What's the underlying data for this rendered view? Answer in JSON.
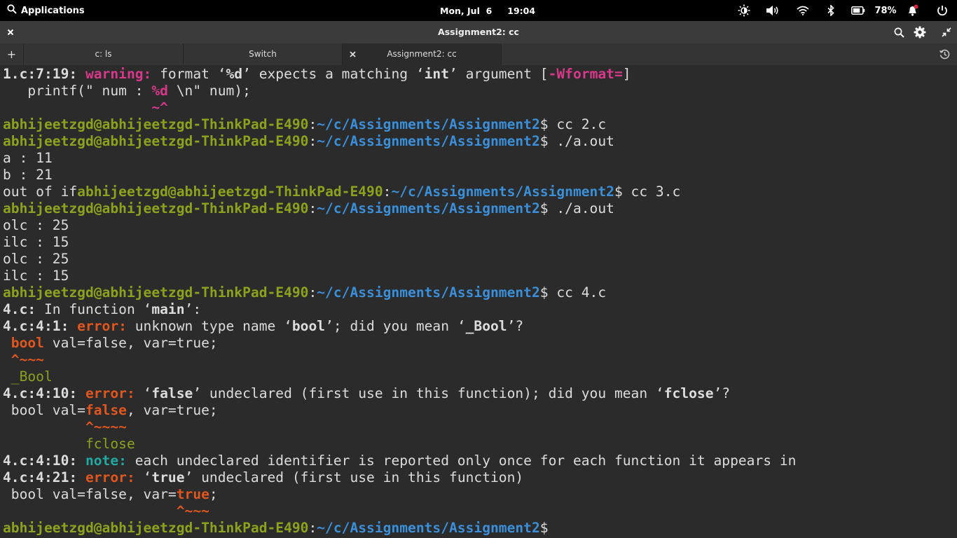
{
  "top_panel": {
    "applications_label": "Applications",
    "date": "Mon, Jul  6",
    "time": "19:04",
    "battery_percent": "78%",
    "indicators": [
      "night-light-icon",
      "volume-icon",
      "wifi-icon",
      "bluetooth-icon",
      "battery-icon",
      "notifications-icon",
      "power-icon"
    ]
  },
  "window": {
    "title": "Assignment2: cc",
    "tabs": [
      {
        "label": "c: ls"
      },
      {
        "label": "Switch"
      },
      {
        "label": "Assignment2: cc"
      }
    ]
  },
  "colors": {
    "user": "#8ca21c",
    "path": "#3a8fd8",
    "warning": "#d8388a",
    "error": "#e0561f",
    "note": "#1fa9a0"
  },
  "terminal": {
    "lines": [
      [
        {
          "t": "1.c:7:19: ",
          "s": "b"
        },
        {
          "t": "warning:",
          "s": "warn"
        },
        {
          "t": " format ‘"
        },
        {
          "t": "%d",
          "s": "b"
        },
        {
          "t": "’ expects a matching ‘"
        },
        {
          "t": "int",
          "s": "b"
        },
        {
          "t": "’ argument ["
        },
        {
          "t": "-Wformat=",
          "s": "warn"
        },
        {
          "t": "]"
        }
      ],
      [
        {
          "t": "   printf(\" num : "
        },
        {
          "t": "%d",
          "s": "warn"
        },
        {
          "t": " \\n\" num);"
        }
      ],
      [
        {
          "t": "                  "
        },
        {
          "t": "~^",
          "s": "warn"
        }
      ],
      [
        {
          "t": "abhijeetzgd@abhijeetzgd-ThinkPad-E490",
          "s": "usr"
        },
        {
          "t": ":"
        },
        {
          "t": "~/c/Assignments/Assignment2",
          "s": "pth"
        },
        {
          "t": "$ cc 2.c"
        }
      ],
      [
        {
          "t": "abhijeetzgd@abhijeetzgd-ThinkPad-E490",
          "s": "usr"
        },
        {
          "t": ":"
        },
        {
          "t": "~/c/Assignments/Assignment2",
          "s": "pth"
        },
        {
          "t": "$ ./a.out"
        }
      ],
      [
        {
          "t": "a : 11"
        }
      ],
      [
        {
          "t": "b : 21"
        }
      ],
      [
        {
          "t": "out of if"
        },
        {
          "t": "abhijeetzgd@abhijeetzgd-ThinkPad-E490",
          "s": "usr"
        },
        {
          "t": ":"
        },
        {
          "t": "~/c/Assignments/Assignment2",
          "s": "pth"
        },
        {
          "t": "$ cc 3.c"
        }
      ],
      [
        {
          "t": "abhijeetzgd@abhijeetzgd-ThinkPad-E490",
          "s": "usr"
        },
        {
          "t": ":"
        },
        {
          "t": "~/c/Assignments/Assignment2",
          "s": "pth"
        },
        {
          "t": "$ ./a.out"
        }
      ],
      [
        {
          "t": "olc : 25"
        }
      ],
      [
        {
          "t": "ilc : 15"
        }
      ],
      [
        {
          "t": "olc : 25"
        }
      ],
      [
        {
          "t": "ilc : 15"
        }
      ],
      [
        {
          "t": "abhijeetzgd@abhijeetzgd-ThinkPad-E490",
          "s": "usr"
        },
        {
          "t": ":"
        },
        {
          "t": "~/c/Assignments/Assignment2",
          "s": "pth"
        },
        {
          "t": "$ cc 4.c"
        }
      ],
      [
        {
          "t": "4.c:",
          "s": "b"
        },
        {
          "t": " In function ‘"
        },
        {
          "t": "main",
          "s": "b"
        },
        {
          "t": "’:"
        }
      ],
      [
        {
          "t": "4.c:4:1: ",
          "s": "b"
        },
        {
          "t": "error:",
          "s": "err"
        },
        {
          "t": " unknown type name ‘"
        },
        {
          "t": "bool",
          "s": "b"
        },
        {
          "t": "’; did you mean ‘"
        },
        {
          "t": "_Bool",
          "s": "b"
        },
        {
          "t": "’?"
        }
      ],
      [
        {
          "t": " "
        },
        {
          "t": "bool",
          "s": "err"
        },
        {
          "t": " val=false, var=true;"
        }
      ],
      [
        {
          "t": " "
        },
        {
          "t": "^~~~",
          "s": "err"
        }
      ],
      [
        {
          "t": " "
        },
        {
          "t": "_Bool",
          "s": "sugg"
        }
      ],
      [
        {
          "t": "4.c:4:10: ",
          "s": "b"
        },
        {
          "t": "error:",
          "s": "err"
        },
        {
          "t": " ‘"
        },
        {
          "t": "false",
          "s": "b"
        },
        {
          "t": "’ undeclared (first use in this function); did you mean ‘"
        },
        {
          "t": "fclose",
          "s": "b"
        },
        {
          "t": "’?"
        }
      ],
      [
        {
          "t": " bool val="
        },
        {
          "t": "false",
          "s": "err"
        },
        {
          "t": ", var=true;"
        }
      ],
      [
        {
          "t": "          "
        },
        {
          "t": "^~~~~",
          "s": "err"
        }
      ],
      [
        {
          "t": "          "
        },
        {
          "t": "fclose",
          "s": "sugg"
        }
      ],
      [
        {
          "t": "4.c:4:10: ",
          "s": "b"
        },
        {
          "t": "note:",
          "s": "note"
        },
        {
          "t": " each undeclared identifier is reported only once for each function it appears in"
        }
      ],
      [
        {
          "t": "4.c:4:21: ",
          "s": "b"
        },
        {
          "t": "error:",
          "s": "err"
        },
        {
          "t": " ‘"
        },
        {
          "t": "true",
          "s": "b"
        },
        {
          "t": "’ undeclared (first use in this function)"
        }
      ],
      [
        {
          "t": " bool val=false, var="
        },
        {
          "t": "true",
          "s": "err"
        },
        {
          "t": ";"
        }
      ],
      [
        {
          "t": "                     "
        },
        {
          "t": "^~~~",
          "s": "err"
        }
      ],
      [
        {
          "t": "abhijeetzgd@abhijeetzgd-ThinkPad-E490",
          "s": "usr"
        },
        {
          "t": ":"
        },
        {
          "t": "~/c/Assignments/Assignment2",
          "s": "pth"
        },
        {
          "t": "$ "
        }
      ]
    ]
  }
}
